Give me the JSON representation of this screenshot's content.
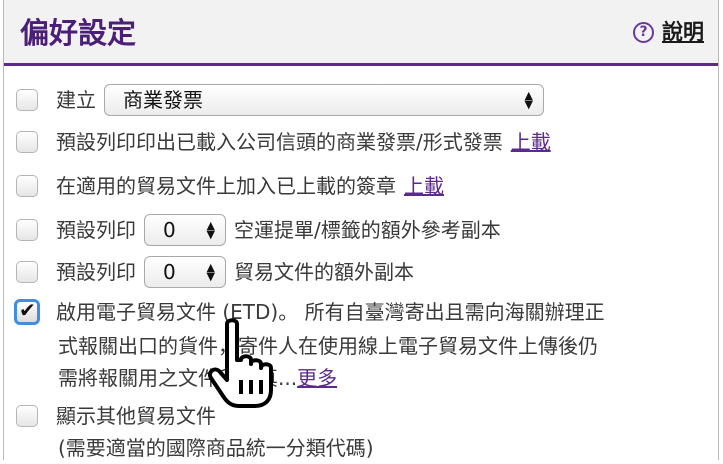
{
  "header": {
    "title": "偏好設定",
    "help_icon": "question-circle-icon",
    "help_label": "說明"
  },
  "rows": {
    "create": {
      "label": "建立",
      "select_value": "商業發票"
    },
    "letterhead": {
      "text": "預設列印印出已載入公司信頭的商業發票/形式發票",
      "link": "上載"
    },
    "signature": {
      "text": "在適用的貿易文件上加入已上載的簽章",
      "link": "上載"
    },
    "awb_copies": {
      "prefix": "預設列印",
      "value": "0",
      "suffix": "空運提單/標籤的額外參考副本"
    },
    "trade_copies": {
      "prefix": "預設列印",
      "value": "0",
      "suffix": "貿易文件的額外副本"
    },
    "etd": {
      "line1": "啟用電子貿易文件 (ETD)。 所有自臺灣寄出且需向海關辦理正",
      "line2": "式報關出口的貨件，寄件人在使用線上電子貿易文件上傳後仍",
      "line3": "需將報關用之文件印出真...",
      "more_link": "更多",
      "checked": true
    },
    "other_docs": {
      "line1": "顯示其他貿易文件",
      "line2": "(需要適當的國際商品統一分類代碼)"
    }
  }
}
